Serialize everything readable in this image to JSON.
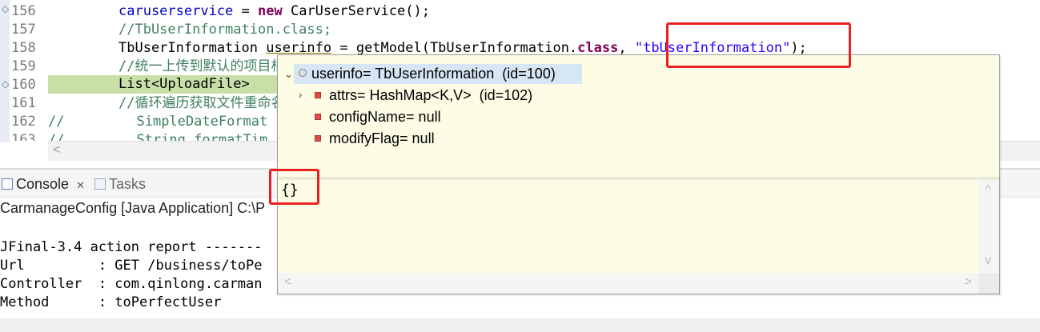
{
  "editor": {
    "lines": [
      {
        "num": "156"
      },
      {
        "num": "157"
      },
      {
        "num": "158"
      },
      {
        "num": "159"
      },
      {
        "num": "160"
      },
      {
        "num": "161"
      },
      {
        "num": "162"
      },
      {
        "num": "163"
      }
    ],
    "code": {
      "l156_var": "caruserservice",
      "l156_eq": " = ",
      "l156_new": "new",
      "l156_rest": " CarUserService();",
      "l157": "//TbUserInformation.class;",
      "l158_type": "TbUserInformation ",
      "l158_var": "userinfo",
      "l158_mid": " = getModel(TbUserInformation.",
      "l158_class": "class",
      "l158_comma": ", ",
      "l158_str": "\"tbUserInformation\"",
      "l158_end": ");",
      "l159": "//统一上传到默认的项目根目",
      "l160": "List<UploadFile>",
      "l161": "//循环遍历获取文件重命名,",
      "l162_cm": "//",
      "l162_rest": "SimpleDateFormat",
      "l163_cm": "//",
      "l163_rest": "String formatTim"
    },
    "scroll_left": "<"
  },
  "views": {
    "tabs": [
      {
        "label": "Console",
        "close": "✕"
      },
      {
        "label": "Tasks"
      }
    ],
    "console_desc": "CarmanageConfig [Java Application] C:\\P",
    "console_lines": [
      "JFinal-3.4 action report -------",
      "Url         : GET /business/toPe",
      "Controller  : com.qinlong.carman",
      "Method      : toPerfectUser"
    ]
  },
  "popup": {
    "tree": [
      {
        "label": "userinfo= TbUserInformation  (id=100)",
        "expanded": true,
        "selected": true
      },
      {
        "label": "attrs= HashMap<K,V>  (id=102)",
        "expandable": true
      },
      {
        "label": "configName= null"
      },
      {
        "label": "modifyFlag= null"
      }
    ],
    "detail": "{}",
    "scroll": {
      "up": "^",
      "down": "v",
      "left": "<",
      "right": ">"
    }
  },
  "colors": {
    "annotation": "#ea2020",
    "popup_bg": "#fdfde6",
    "selection": "#d7e6f4",
    "highlight_line": "#c8e0a8"
  }
}
